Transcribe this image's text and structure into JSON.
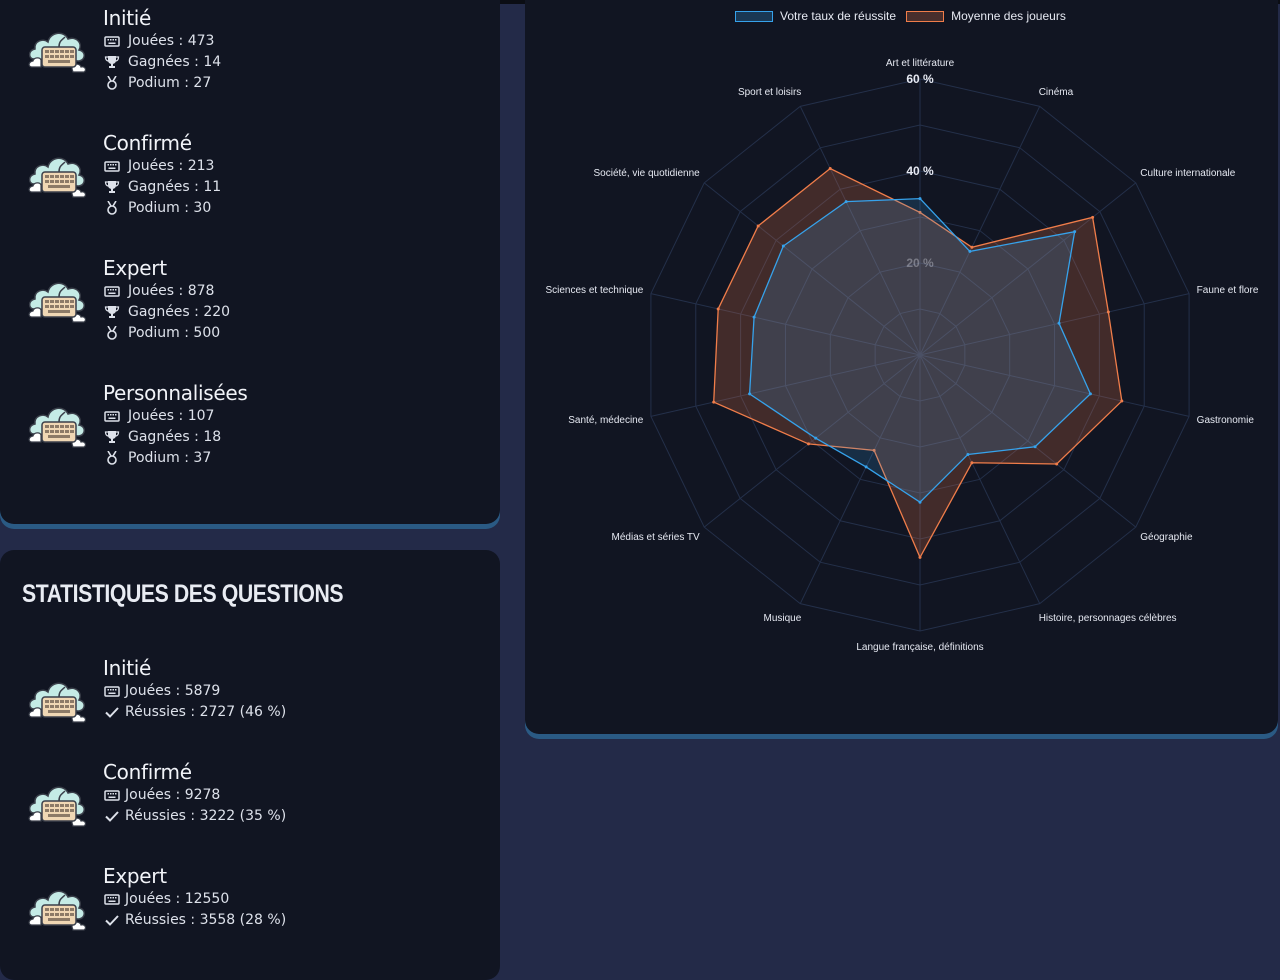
{
  "games": {
    "items": [
      {
        "title": "Initié",
        "played_label": "Jouées : 473",
        "won_label": "Gagnées : 14",
        "podium_label": "Podium : 27"
      },
      {
        "title": "Confirmé",
        "played_label": "Jouées : 213",
        "won_label": "Gagnées : 11",
        "podium_label": "Podium : 30"
      },
      {
        "title": "Expert",
        "played_label": "Jouées : 878",
        "won_label": "Gagnées : 220",
        "podium_label": "Podium : 500"
      },
      {
        "title": "Personnalisées",
        "played_label": "Jouées : 107",
        "won_label": "Gagnées : 18",
        "podium_label": "Podium : 37"
      }
    ]
  },
  "questions": {
    "title": "Statistiques des questions",
    "items": [
      {
        "title": "Initié",
        "played_label": "Jouées : 5879",
        "success_label": "Réussies : 2727 (46 %)"
      },
      {
        "title": "Confirmé",
        "played_label": "Jouées : 9278",
        "success_label": "Réussies : 3222 (35 %)"
      },
      {
        "title": "Expert",
        "played_label": "Jouées : 12550",
        "success_label": "Réussies : 3558 (28 %)"
      }
    ]
  },
  "icons": {
    "avatar": "keyboard-cloud-icon",
    "played": "keyboard-icon",
    "won": "trophy-icon",
    "podium": "medal-icon",
    "success": "check-icon"
  },
  "colors": {
    "page_bg": "#232a48",
    "card_bg": "#111522",
    "card_shadow": "#2a5a84",
    "series_user": "#36a2eb",
    "series_avg": "#f07d4a",
    "grid": "#24304a"
  },
  "chart_data": {
    "type": "radar",
    "title": "",
    "categories": [
      "Art et littérature",
      "Cinéma",
      "Culture internationale",
      "Faune et flore",
      "Gastronomie",
      "Géographie",
      "Histoire, personnages célèbres",
      "Langue française, définitions",
      "Musique",
      "Médias et séries TV",
      "Santé, médecine",
      "Sciences et technique",
      "Société, vie quotidienne",
      "Sport et loisirs"
    ],
    "series": [
      {
        "name": "Votre taux de réussite",
        "values": [
          34,
          25,
          43,
          31,
          38,
          32,
          24,
          32,
          27,
          29,
          38,
          37,
          38,
          37
        ]
      },
      {
        "name": "Moyenne des joueurs",
        "values": [
          31,
          26,
          48,
          42,
          45,
          38,
          26,
          44,
          23,
          31,
          46,
          45,
          45,
          45
        ]
      }
    ],
    "r_ticks": [
      "20 %",
      "40 %",
      "60 %"
    ],
    "r_range": [
      0,
      60
    ],
    "grid": true,
    "legend_position": "top"
  }
}
